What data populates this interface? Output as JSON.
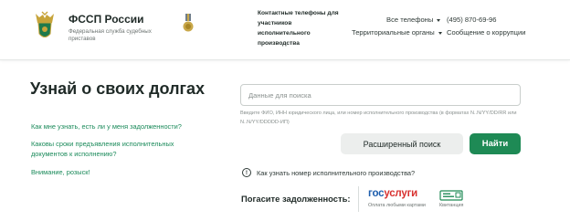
{
  "header": {
    "brand_title": "ФССП России",
    "brand_subtitle": "Федеральная служба судебных приставов",
    "contacts_title": "Контактные телефоны для участников исполнительного производства",
    "all_phones": "Все телефоны",
    "territorial": "Территориальные органы",
    "phone": "(495) 870-69-96",
    "corruption": "Сообщение о коррупции"
  },
  "main": {
    "title": "Узнай о своих долгах",
    "side_links": [
      "Как мне узнать, есть ли у меня задолженности?",
      "Каковы сроки предъявления исполнительных документов к исполнению?",
      "Внимание, розыск!"
    ]
  },
  "search": {
    "placeholder": "Данные для поиска",
    "hint": "Введите ФИО, ИНН юридического лица, или номер исполнительного производства (в форматах N..N/YY/DD/RR или N..N/YY/DDDDD-ИП)",
    "advanced_label": "Расширенный поиск",
    "find_label": "Найти"
  },
  "info": {
    "icon": "!",
    "text": "Как узнать номер исполнительного производства?"
  },
  "payment": {
    "label": "Погасите задолженность:",
    "gosuslugi_part1": "гос",
    "gosuslugi_part2": "услуги",
    "gosuslugi_caption": "Оплата любыми картами",
    "receipt_caption": "Квитанция"
  },
  "colors": {
    "accent_green": "#1e8a55",
    "link_green": "#1a8a5a",
    "gos_blue": "#1f5fae",
    "gos_red": "#d8312f"
  }
}
